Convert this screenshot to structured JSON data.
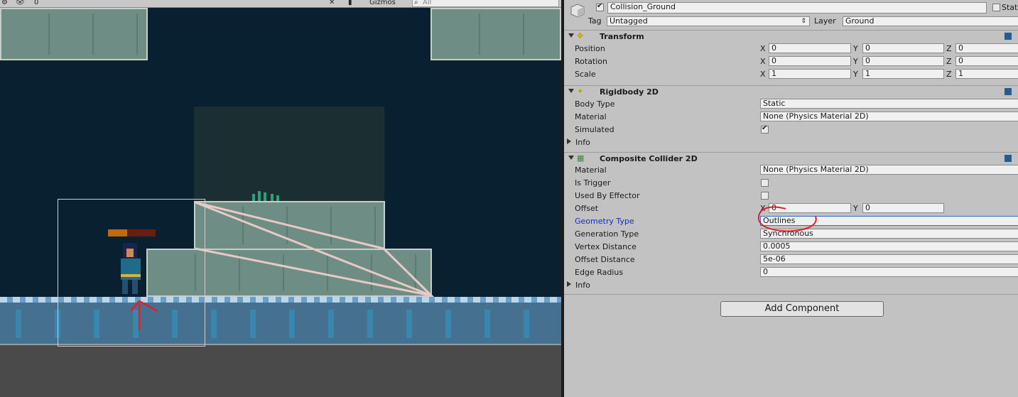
{
  "scene": {
    "toolbar": {
      "count": "0",
      "gizmos": "Gizmos",
      "search_placeholder": "All"
    }
  },
  "inspector": {
    "header": {
      "active": true,
      "name": "Collision_Ground",
      "static_label": "Stat",
      "tag_label": "Tag",
      "tag_value": "Untagged",
      "layer_label": "Layer",
      "layer_value": "Ground"
    },
    "transform": {
      "title": "Transform",
      "position": {
        "label": "Position",
        "x": "0",
        "y": "0",
        "z": "0"
      },
      "rotation": {
        "label": "Rotation",
        "x": "0",
        "y": "0",
        "z": "0"
      },
      "scale": {
        "label": "Scale",
        "x": "1",
        "y": "1",
        "z": "1"
      }
    },
    "rigidbody": {
      "title": "Rigidbody 2D",
      "body_type_label": "Body Type",
      "body_type": "Static",
      "material_label": "Material",
      "material": "None (Physics Material 2D)",
      "simulated_label": "Simulated",
      "simulated": true,
      "info_label": "Info"
    },
    "composite": {
      "title": "Composite Collider 2D",
      "material_label": "Material",
      "material": "None (Physics Material 2D)",
      "is_trigger_label": "Is Trigger",
      "is_trigger": false,
      "used_by_effector_label": "Used By Effector",
      "used_by_effector": false,
      "offset_label": "Offset",
      "offset_x": "0",
      "offset_y": "0",
      "geometry_type_label": "Geometry Type",
      "geometry_type": "Outlines",
      "generation_type_label": "Generation Type",
      "generation_type": "Synchronous",
      "vertex_distance_label": "Vertex Distance",
      "vertex_distance": "0.0005",
      "offset_distance_label": "Offset Distance",
      "offset_distance": "5e-06",
      "edge_radius_label": "Edge Radius",
      "edge_radius": "0",
      "info_label": "Info"
    },
    "add_component_label": "Add Component"
  },
  "axes": {
    "x": "X",
    "y": "Y",
    "z": "Z"
  },
  "colors": {
    "scene_bg": "#082030",
    "tile": "#6e8e85",
    "water": "#45708f",
    "annotation": "#e0202a",
    "highlight_label": "#1030c0"
  }
}
